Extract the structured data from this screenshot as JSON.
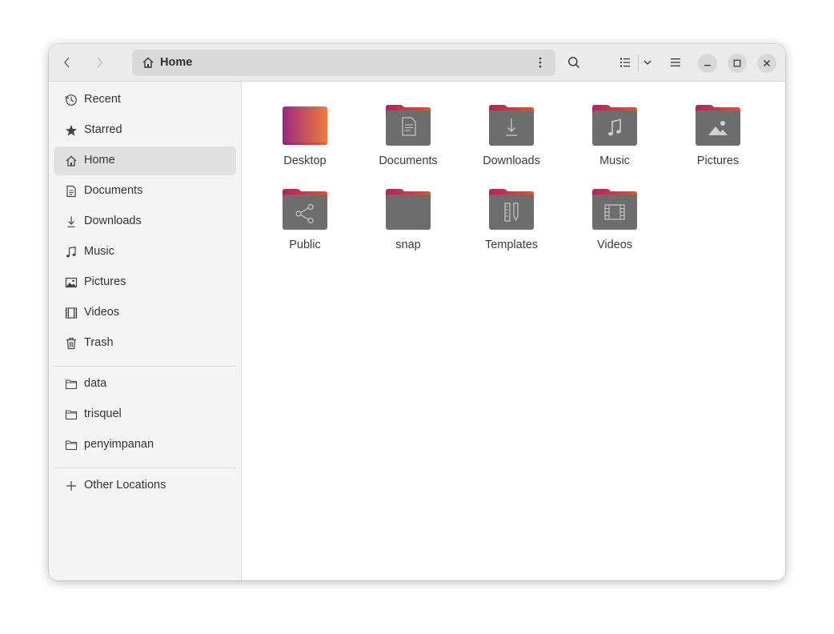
{
  "header": {
    "path_label": "Home"
  },
  "sidebar": {
    "places": [
      {
        "label": "Recent",
        "icon": "clock-icon"
      },
      {
        "label": "Starred",
        "icon": "star-icon"
      },
      {
        "label": "Home",
        "icon": "home-icon",
        "active": true
      },
      {
        "label": "Documents",
        "icon": "document-icon"
      },
      {
        "label": "Downloads",
        "icon": "download-icon"
      },
      {
        "label": "Music",
        "icon": "music-note-icon"
      },
      {
        "label": "Pictures",
        "icon": "picture-icon"
      },
      {
        "label": "Videos",
        "icon": "film-icon"
      },
      {
        "label": "Trash",
        "icon": "trash-icon"
      }
    ],
    "bookmarks": [
      {
        "label": "data",
        "icon": "folder-icon"
      },
      {
        "label": "trisquel",
        "icon": "folder-icon"
      },
      {
        "label": "penyimpanan",
        "icon": "folder-icon"
      }
    ],
    "other_locations": {
      "label": "Other Locations",
      "icon": "plus-icon"
    }
  },
  "files": [
    {
      "label": "Desktop",
      "icon": "desktop-folder-icon"
    },
    {
      "label": "Documents",
      "icon": "documents-folder-icon"
    },
    {
      "label": "Downloads",
      "icon": "downloads-folder-icon"
    },
    {
      "label": "Music",
      "icon": "music-folder-icon"
    },
    {
      "label": "Pictures",
      "icon": "pictures-folder-icon"
    },
    {
      "label": "Public",
      "icon": "public-folder-icon"
    },
    {
      "label": "snap",
      "icon": "folder-icon"
    },
    {
      "label": "Templates",
      "icon": "templates-folder-icon"
    },
    {
      "label": "Videos",
      "icon": "videos-folder-icon"
    }
  ],
  "colors": {
    "folder_tab": "#c7245f",
    "folder_tab_end": "#e8502c",
    "folder_body": "#6d6d6d",
    "desktop_start": "#8f2c7e",
    "desktop_end": "#f07a3c"
  }
}
